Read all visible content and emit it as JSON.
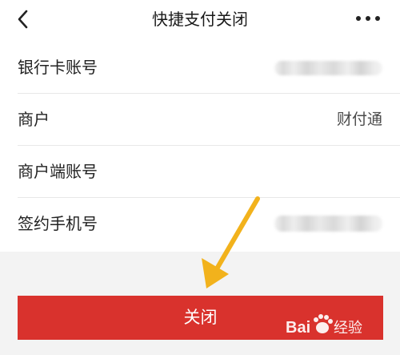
{
  "header": {
    "title": "快捷支付关闭",
    "back_icon": "chevron-left-icon",
    "more_icon": "more-horizontal-icon"
  },
  "rows": [
    {
      "label": "银行卡账号",
      "value": ""
    },
    {
      "label": "商户",
      "value": "财付通"
    },
    {
      "label": "商户端账号",
      "value": ""
    },
    {
      "label": "签约手机号",
      "value": ""
    }
  ],
  "close_button": {
    "label": "关闭"
  },
  "annotation": {
    "arrow_color": "#f2b21c",
    "arrow_icon": "arrow-down-left-icon"
  },
  "watermark": {
    "text": "Bai经验",
    "logo_icon": "baidu-paw-icon"
  },
  "colors": {
    "accent": "#d9322d",
    "background": "#f3f3f3"
  }
}
